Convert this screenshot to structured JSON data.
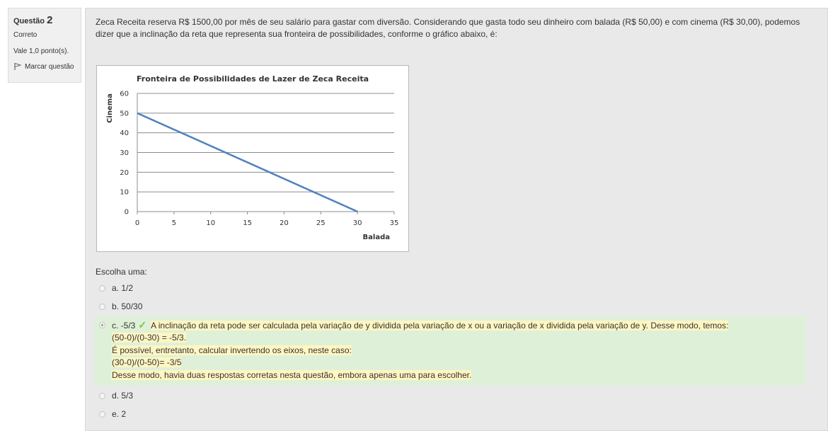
{
  "info": {
    "question_label": "Questão",
    "question_number": "2",
    "state": "Correto",
    "grade": "Vale 1,0 ponto(s).",
    "flag_label": "Marcar questão"
  },
  "question": {
    "text": "Zeca Receita reserva R$ 1500,00 por mês de seu salário para gastar com diversão. Considerando que gasta todo seu dinheiro com balada (R$ 50,00) e com cinema (R$ 30,00), podemos dizer que a inclinação da reta que representa sua fronteira de possibilidades, conforme o gráfico abaixo, é:",
    "prompt": "Escolha uma:"
  },
  "chart_data": {
    "type": "line",
    "title": "Fronteira de Possibilidades de Lazer de Zeca Receita",
    "xlabel": "Balada",
    "ylabel": "Cinema",
    "xlim": [
      0,
      35
    ],
    "ylim": [
      0,
      60
    ],
    "xticks": [
      0,
      5,
      10,
      15,
      20,
      25,
      30,
      35
    ],
    "yticks": [
      0,
      10,
      20,
      30,
      40,
      50,
      60
    ],
    "grid": "horizontal",
    "color": "#4f81bd",
    "series": [
      {
        "x": [
          0,
          30
        ],
        "y": [
          50,
          0
        ]
      }
    ]
  },
  "options": [
    {
      "label": "a. 1/2",
      "selected": false
    },
    {
      "label": "b. 50/30",
      "selected": false
    },
    {
      "label": "c. -5/3",
      "selected": true
    },
    {
      "label": "d. 5/3",
      "selected": false
    },
    {
      "label": "e. 2",
      "selected": false
    }
  ],
  "feedback": {
    "line1": "A inclinação da reta pode ser calculada pela variação de y dividida pela variação de x ou a variação de x dividida pela variação de y. Desse modo, temos:",
    "line2": "(50-0)/(0-30) = -5/3.",
    "line3": "É possível, entretanto, calcular invertendo os eixos, neste caso:",
    "line4": "(30-0)/(0-50)= -3/5",
    "line5": "Desse modo, havia duas respostas corretas nesta questão, embora apenas uma para escolher."
  }
}
